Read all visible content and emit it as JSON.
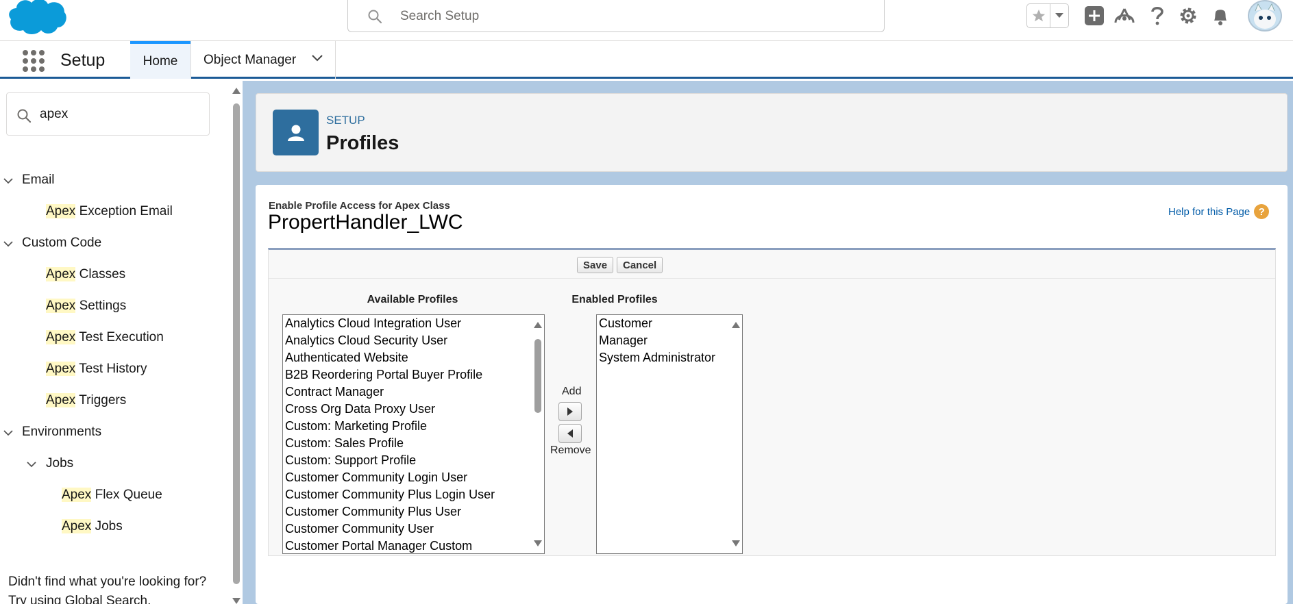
{
  "header": {
    "search_placeholder": "Search Setup"
  },
  "context_bar": {
    "app_name": "Setup",
    "tabs": [
      {
        "label": "Home"
      },
      {
        "label": "Object Manager"
      }
    ]
  },
  "sidebar": {
    "quick_find_value": "apex",
    "highlight": "Apex",
    "sections": [
      {
        "label": "Email",
        "items": [
          {
            "rest": " Exception Email"
          }
        ]
      },
      {
        "label": "Custom Code",
        "items": [
          {
            "rest": " Classes"
          },
          {
            "rest": " Settings"
          },
          {
            "rest": " Test Execution"
          },
          {
            "rest": " Test History"
          },
          {
            "rest": " Triggers"
          }
        ]
      },
      {
        "label": "Environments",
        "sub": {
          "label": "Jobs",
          "items": [
            {
              "rest": " Flex Queue"
            },
            {
              "rest": " Jobs"
            }
          ]
        }
      }
    ],
    "help_line1": "Didn't find what you're looking for?",
    "help_line2": "Try using Global Search."
  },
  "page_header": {
    "label": "SETUP",
    "title": "Profiles"
  },
  "content": {
    "subtitle": "Enable Profile Access for Apex Class",
    "title": "PropertHandler_LWC",
    "help_link": "Help for this Page",
    "save_label": "Save",
    "cancel_label": "Cancel",
    "available_label": "Available Profiles",
    "enabled_label": "Enabled Profiles",
    "add_label": "Add",
    "remove_label": "Remove",
    "available_profiles": [
      "Analytics Cloud Integration User",
      "Analytics Cloud Security User",
      "Authenticated Website",
      "B2B Reordering Portal Buyer Profile",
      "Contract Manager",
      "Cross Org Data Proxy User",
      "Custom: Marketing Profile",
      "Custom: Sales Profile",
      "Custom: Support Profile",
      "Customer Community Login User",
      "Customer Community Plus Login User",
      "Customer Community Plus User",
      "Customer Community User",
      "Customer Portal Manager Custom"
    ],
    "enabled_profiles": [
      "Customer",
      "Manager",
      "System Administrator"
    ]
  },
  "colors": {
    "brand_blue": "#1b96ff",
    "setup_icon_bg": "#2e6e9e",
    "highlight_yellow": "#fff8c4",
    "link_blue": "#015ba7"
  }
}
